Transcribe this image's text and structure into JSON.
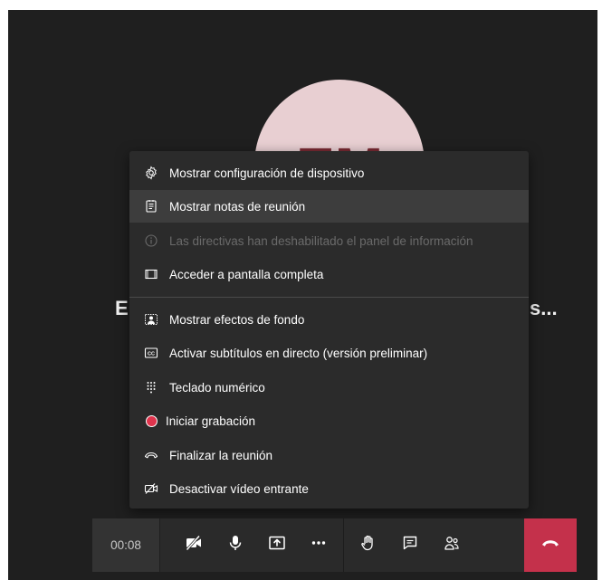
{
  "participant": {
    "initials": "EM",
    "name_left": "E",
    "name_right": "s..."
  },
  "menu": {
    "items": [
      {
        "label": "Mostrar configuración de dispositivo",
        "icon": "gear-icon"
      },
      {
        "label": "Mostrar notas de reunión",
        "icon": "notes-icon"
      },
      {
        "label": "Las directivas han deshabilitado el panel de información",
        "icon": "info-icon"
      },
      {
        "label": "Acceder a pantalla completa",
        "icon": "fullscreen-icon"
      },
      {
        "label": "Mostrar efectos de fondo",
        "icon": "background-effects-icon"
      },
      {
        "label": "Activar subtítulos en directo (versión preliminar)",
        "icon": "closed-captions-icon"
      },
      {
        "label": "Teclado numérico",
        "icon": "dialpad-icon"
      },
      {
        "label": "Iniciar grabación",
        "icon": "record-icon"
      },
      {
        "label": "Finalizar la reunión",
        "icon": "end-meeting-icon"
      },
      {
        "label": "Desactivar vídeo entrante",
        "icon": "video-off-icon"
      }
    ],
    "hovered_index": 1,
    "disabled_index": 2
  },
  "toolbar": {
    "timer": "00:08",
    "buttons": [
      "camera-off-icon",
      "microphone-icon",
      "share-screen-icon",
      "more-options-icon",
      "raise-hand-icon",
      "chat-icon",
      "participants-icon",
      "hang-up-icon"
    ]
  },
  "colors": {
    "stage_bg": "#1f1f1f",
    "menu_bg": "#2b2b2b",
    "avatar_bg": "#e8cfd2",
    "avatar_text": "#7a2a33",
    "hangup": "#c4314b",
    "record": "#e0344d"
  }
}
